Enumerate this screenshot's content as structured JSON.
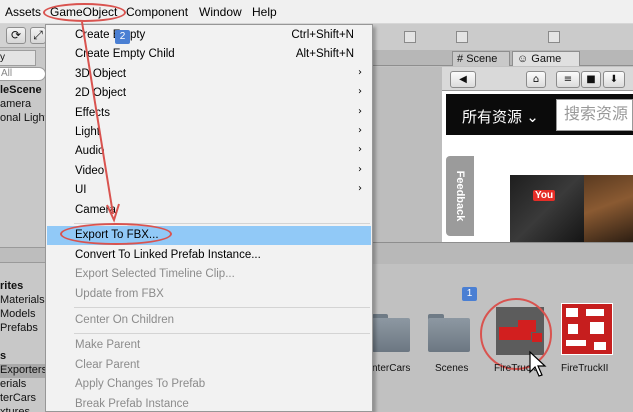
{
  "menubar": {
    "items": [
      "Assets",
      "GameObject",
      "Component",
      "Window",
      "Help"
    ]
  },
  "annotations": {
    "step1": "1",
    "step2": "2"
  },
  "colors": {
    "accent_red": "#d9534f",
    "menu_highlight": "#91c9f7",
    "badge_blue": "#4a7fd3"
  },
  "hierarchy": {
    "tab_label": "y",
    "search_placeholder": "All",
    "items": [
      "leScene",
      "amera",
      "onal Light"
    ]
  },
  "project": {
    "items": [
      "rites",
      "Materials",
      "Models",
      "Prefabs"
    ],
    "section2": "s",
    "items2": [
      "Exporters",
      "erials",
      "terCars",
      "xtures"
    ]
  },
  "tabs": {
    "scene": "Scene",
    "game": "Game"
  },
  "web": {
    "all_resources": "所有资源",
    "search_placeholder": "搜索资源",
    "feedback": "Feedback",
    "video_brand": "You"
  },
  "assets": [
    {
      "label": "nterCars",
      "type": "folder"
    },
    {
      "label": "Scenes",
      "type": "folder"
    },
    {
      "label": "FireTruck",
      "type": "model"
    },
    {
      "label": "FireTruckII",
      "type": "texture"
    }
  ],
  "menu": {
    "items": [
      {
        "label": "Create Empty",
        "shortcut": "Ctrl+Shift+N"
      },
      {
        "label": "Create Empty Child",
        "shortcut": "Alt+Shift+N"
      },
      {
        "label": "3D Object",
        "submenu": true
      },
      {
        "label": "2D Object",
        "submenu": true
      },
      {
        "label": "Effects",
        "submenu": true
      },
      {
        "label": "Light",
        "submenu": true
      },
      {
        "label": "Audio",
        "submenu": true
      },
      {
        "label": "Video",
        "submenu": true
      },
      {
        "label": "UI",
        "submenu": true
      },
      {
        "label": "Camera"
      },
      {
        "label": "Export To FBX...",
        "highlighted": true
      },
      {
        "label": "Convert To Linked Prefab Instance..."
      },
      {
        "label": "Export Selected Timeline Clip...",
        "disabled": true
      },
      {
        "label": "Update from FBX",
        "disabled": true
      },
      {
        "label": "Center On Children",
        "disabled": true
      },
      {
        "label": "Make Parent",
        "disabled": true
      },
      {
        "label": "Clear Parent",
        "disabled": true
      },
      {
        "label": "Apply Changes To Prefab",
        "disabled": true
      },
      {
        "label": "Break Prefab Instance",
        "disabled": true
      }
    ]
  }
}
